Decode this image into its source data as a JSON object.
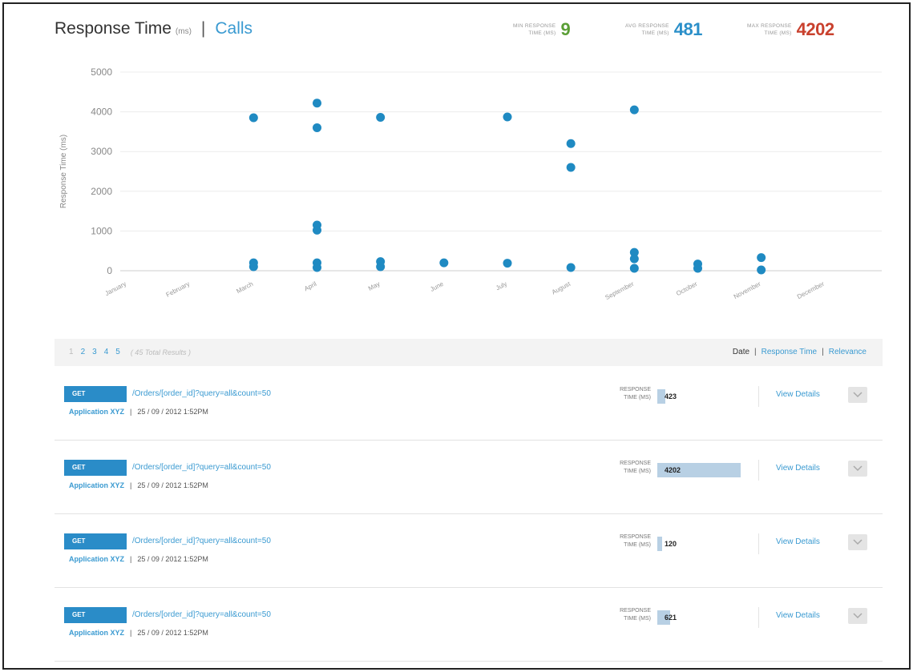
{
  "header": {
    "title": "Response Time",
    "unit": "(ms)",
    "separator": "|",
    "calls_link": "Calls"
  },
  "stats": {
    "min": {
      "label_line1": "MIN RESPONSE",
      "label_line2": "TIME (MS)",
      "value": "9",
      "color": "#5a9e35"
    },
    "avg": {
      "label_line1": "AVG RESPONSE",
      "label_line2": "TIME (MS)",
      "value": "481",
      "color": "#2a8fc9"
    },
    "max": {
      "label_line1": "MAX RESPONSE",
      "label_line2": "TIME (MS)",
      "value": "4202",
      "color": "#c9412e"
    }
  },
  "chart_data": {
    "type": "scatter",
    "ylabel": "Response Time (ms)",
    "xlabel": "",
    "ylim": [
      0,
      5000
    ],
    "yticks": [
      0,
      1000,
      2000,
      3000,
      4000,
      5000
    ],
    "categories": [
      "January",
      "February",
      "March",
      "April",
      "May",
      "June",
      "July",
      "August",
      "September",
      "October",
      "November",
      "December"
    ],
    "grid": true,
    "legend": "none",
    "point_color": "#1f8ac2",
    "points": [
      {
        "x": 2.0,
        "y": 3850
      },
      {
        "x": 2.0,
        "y": 200
      },
      {
        "x": 2.0,
        "y": 100
      },
      {
        "x": 3.0,
        "y": 4220
      },
      {
        "x": 3.0,
        "y": 3600
      },
      {
        "x": 3.0,
        "y": 1150
      },
      {
        "x": 3.0,
        "y": 1020
      },
      {
        "x": 3.0,
        "y": 200
      },
      {
        "x": 3.0,
        "y": 80
      },
      {
        "x": 4.0,
        "y": 3860
      },
      {
        "x": 4.0,
        "y": 230
      },
      {
        "x": 4.0,
        "y": 100
      },
      {
        "x": 5.0,
        "y": 200
      },
      {
        "x": 6.0,
        "y": 3870
      },
      {
        "x": 6.0,
        "y": 190
      },
      {
        "x": 7.0,
        "y": 3200
      },
      {
        "x": 7.0,
        "y": 2600
      },
      {
        "x": 7.0,
        "y": 80
      },
      {
        "x": 8.0,
        "y": 4050
      },
      {
        "x": 8.0,
        "y": 460
      },
      {
        "x": 8.0,
        "y": 300
      },
      {
        "x": 8.0,
        "y": 60
      },
      {
        "x": 9.0,
        "y": 170
      },
      {
        "x": 9.0,
        "y": 60
      },
      {
        "x": 10.0,
        "y": 330
      },
      {
        "x": 10.0,
        "y": 20
      }
    ]
  },
  "results": {
    "pages": [
      "1",
      "2",
      "3",
      "4",
      "5"
    ],
    "total": "( 45 Total Results )",
    "sort": {
      "date": "Date",
      "sep": "|",
      "response_time": "Response Time",
      "relevance": "Relevance"
    }
  },
  "rows": [
    {
      "method": "GET",
      "endpoint": "/Orders/[order_id]?query=all&count=50",
      "app": "Application XYZ",
      "sep": "|",
      "date": "25 / 09 / 2012  1:52PM",
      "rt_label_line1": "RESPONSE",
      "rt_label_line2": "TIME (MS)",
      "rt_value": "423",
      "rt_fraction": 0.1,
      "view": "View Details"
    },
    {
      "method": "GET",
      "endpoint": "/Orders/[order_id]?query=all&count=50",
      "app": "Application XYZ",
      "sep": "|",
      "date": "25 / 09 / 2012  1:52PM",
      "rt_label_line1": "RESPONSE",
      "rt_label_line2": "TIME (MS)",
      "rt_value": "4202",
      "rt_fraction": 1.0,
      "view": "View Details"
    },
    {
      "method": "GET",
      "endpoint": "/Orders/[order_id]?query=all&count=50",
      "app": "Application XYZ",
      "sep": "|",
      "date": "25 / 09 / 2012  1:52PM",
      "rt_label_line1": "RESPONSE",
      "rt_label_line2": "TIME (MS)",
      "rt_value": "120",
      "rt_fraction": 0.03,
      "view": "View Details"
    },
    {
      "method": "GET",
      "endpoint": "/Orders/[order_id]?query=all&count=50",
      "app": "Application XYZ",
      "sep": "|",
      "date": "25 / 09 / 2012  1:52PM",
      "rt_label_line1": "RESPONSE",
      "rt_label_line2": "TIME (MS)",
      "rt_value": "621",
      "rt_fraction": 0.15,
      "view": "View Details"
    }
  ]
}
